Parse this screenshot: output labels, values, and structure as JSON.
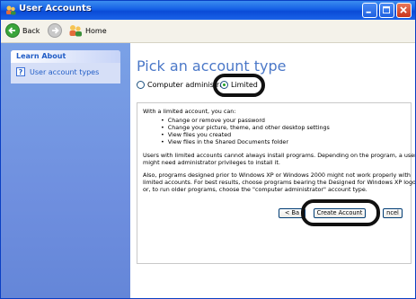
{
  "window": {
    "title": "User Accounts",
    "controls": [
      "minimize",
      "maximize",
      "close"
    ]
  },
  "toolbar": {
    "back_label": "Back",
    "home_label": "Home"
  },
  "sidebar": {
    "panel_title": "Learn About",
    "links": [
      {
        "label": "User account types",
        "icon": "help-icon"
      }
    ]
  },
  "main": {
    "title": "Pick an account type",
    "options": [
      {
        "label": "Computer administrat",
        "checked": false
      },
      {
        "label": "Limited",
        "checked": true
      }
    ],
    "intro": "With a limited account, you can:",
    "bullets": [
      "Change or remove your password",
      "Change your picture, theme, and other desktop settings",
      "View files you created",
      "View files in the Shared Documents folder"
    ],
    "para1_line1": "Users with limited accounts cannot always install programs. Depending on the program, a user",
    "para1_line2": "might need administrator privileges to install it.",
    "para2_line1": "Also, programs designed prior to Windows XP or Windows 2000 might not work properly with",
    "para2_line2": "limited accounts. For best results, choose programs bearing the Designed for Windows XP logo,",
    "para2_line3": "or, to run older programs, choose the \"computer administrator\" account type.",
    "buttons": {
      "back": "< Ba",
      "create": "Create Account",
      "cancel": "ncel"
    }
  },
  "colors": {
    "titlebar": "#0a4bd6",
    "sidebar": "#6f8fdf",
    "title_text": "#4b78c8",
    "highlight_ring": "#111111"
  }
}
